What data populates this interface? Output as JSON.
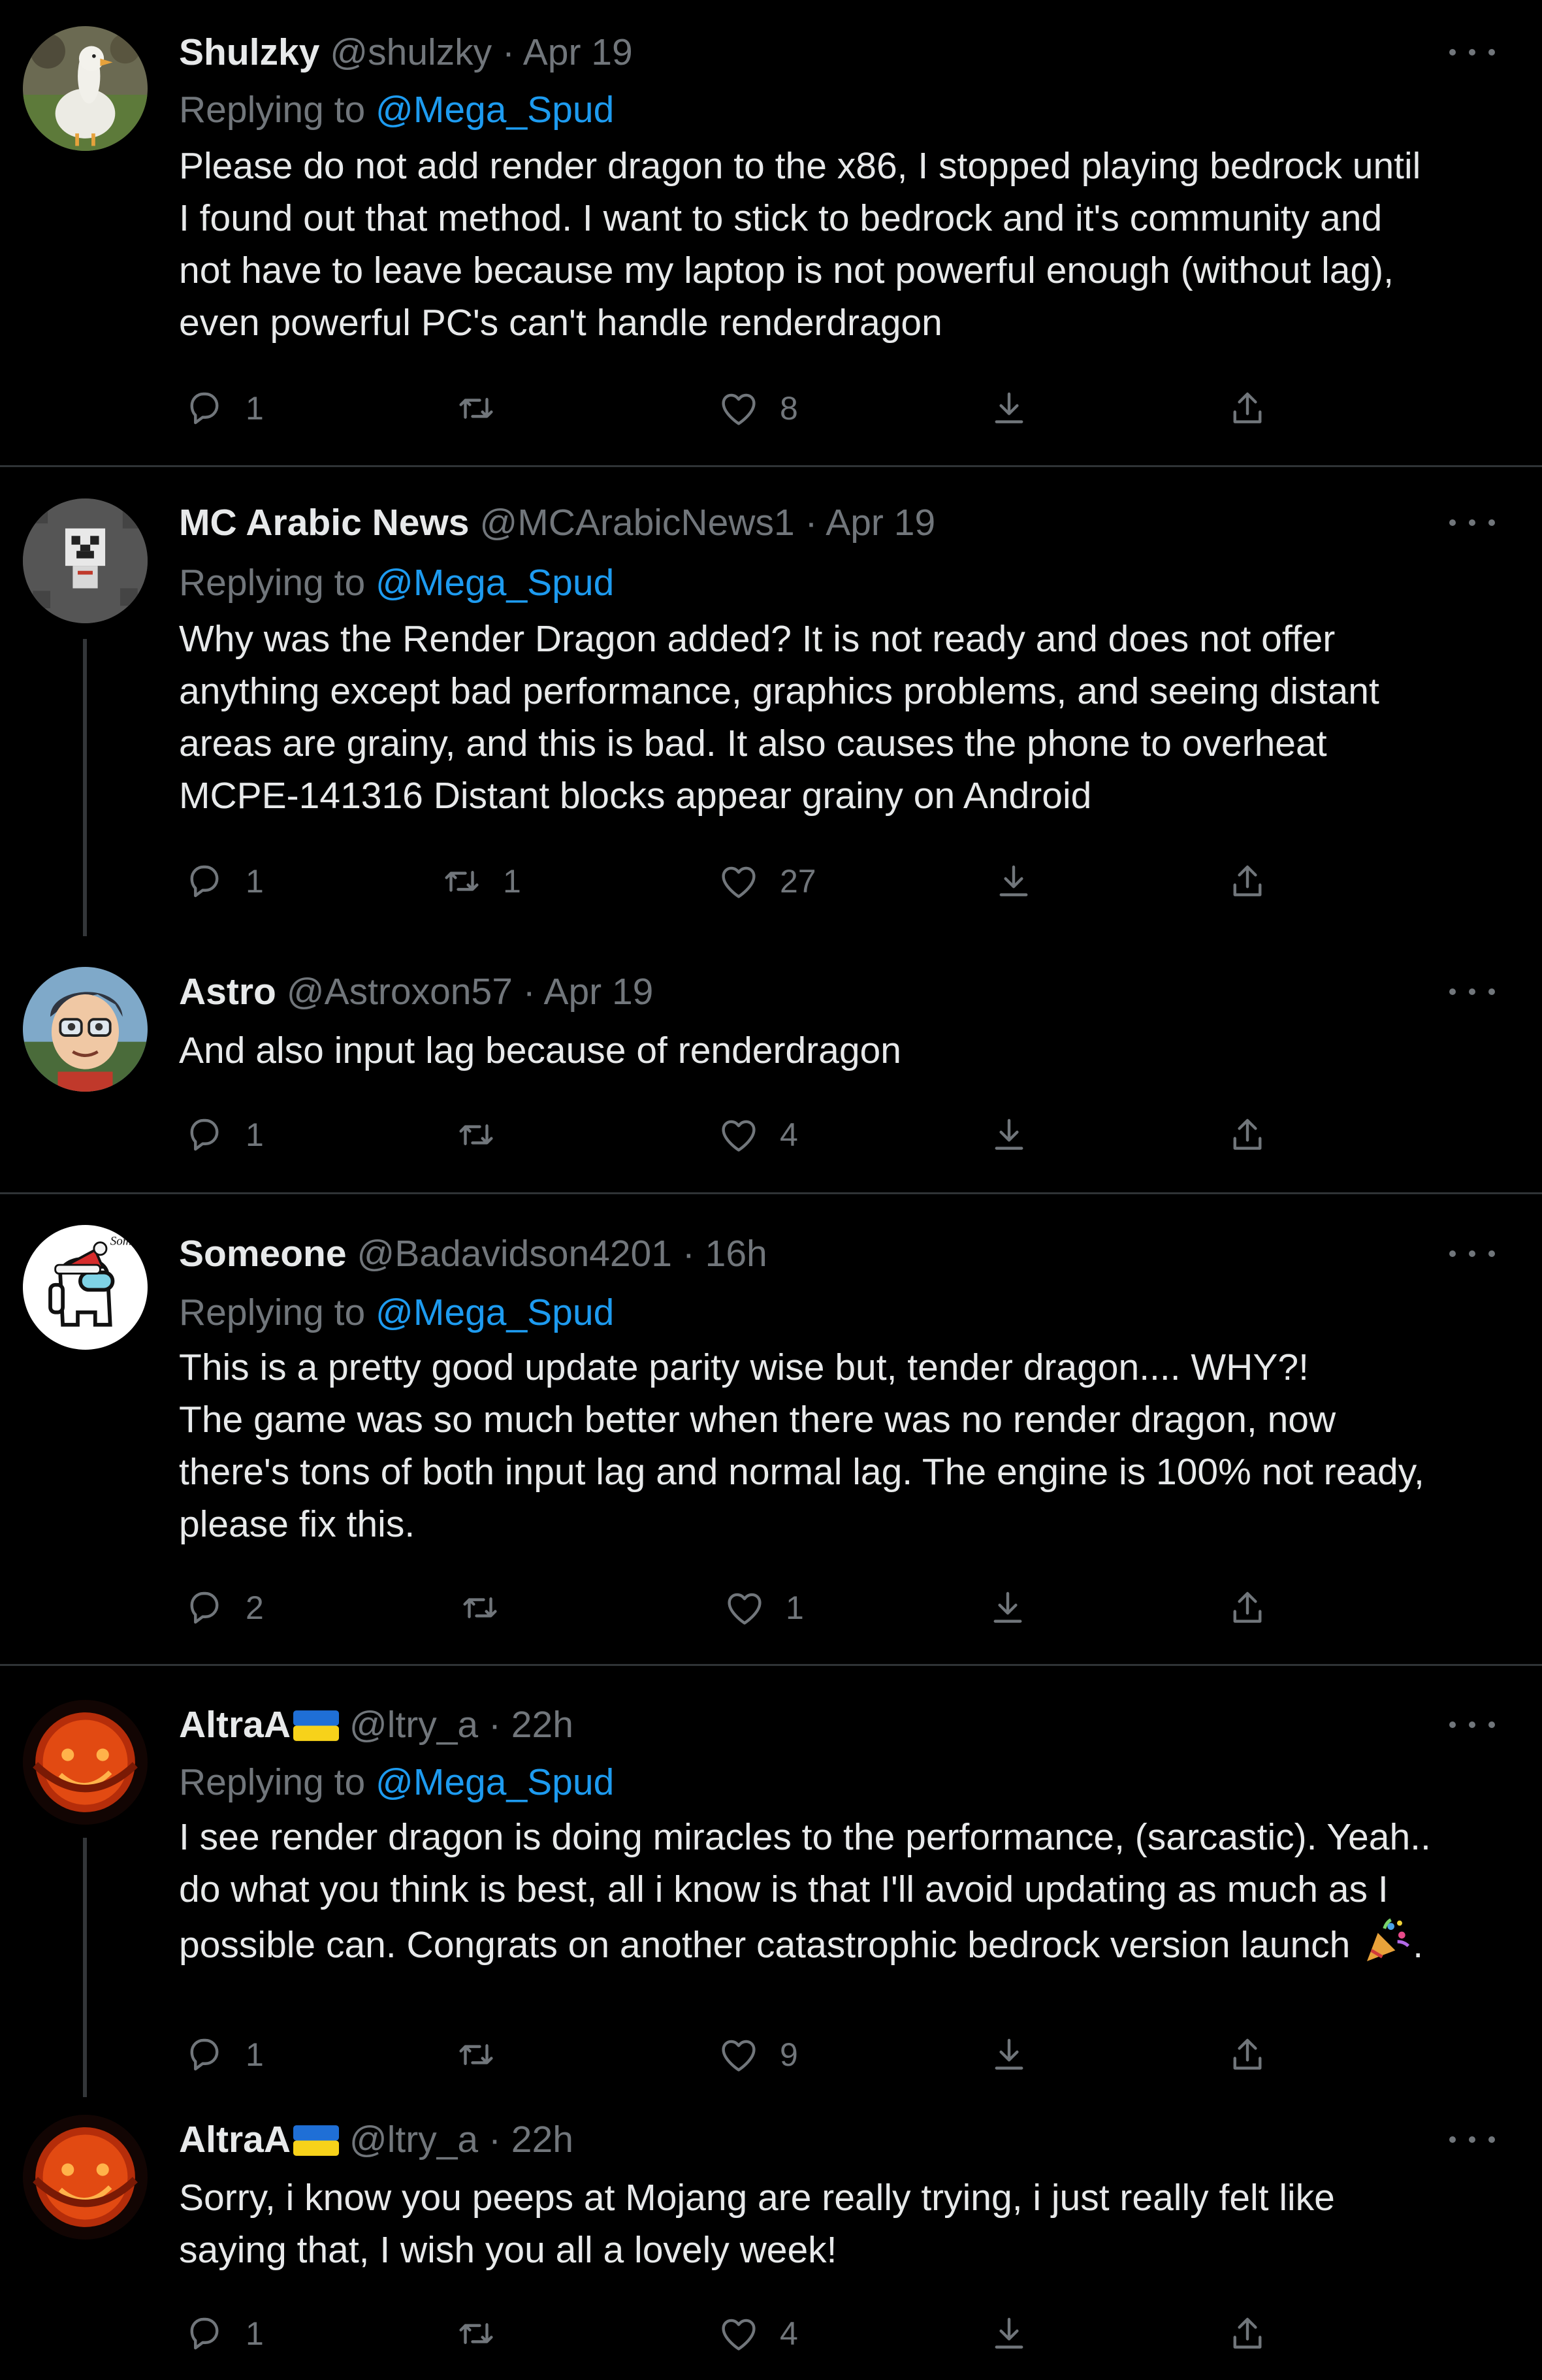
{
  "tweets": [
    {
      "name": "Shulzky",
      "handle": "@shulzky",
      "separator": "·",
      "time": "Apr 19",
      "replying_label": "Replying to",
      "replying_to": "@Mega_Spud",
      "lines": [
        "Please do not add render dragon to the x86, I stopped playing bedrock until",
        "I found out that method. I want to stick to bedrock and it's community and",
        "not have to leave because my laptop is not powerful enough (without lag),",
        "even powerful PC's can't handle renderdragon"
      ],
      "reply_count": "1",
      "retweet_count": "",
      "like_count": "8"
    },
    {
      "name": "MC Arabic News",
      "handle": "@MCArabicNews1",
      "separator": "·",
      "time": "Apr 19",
      "replying_label": "Replying to",
      "replying_to": "@Mega_Spud",
      "lines": [
        "Why was the Render Dragon added? It is not ready and does not offer",
        "anything except bad performance, graphics problems, and seeing distant",
        "areas are grainy, and this is bad. It also causes the phone to overheat",
        "MCPE-141316 Distant blocks appear grainy on Android"
      ],
      "reply_count": "1",
      "retweet_count": "1",
      "like_count": "27"
    },
    {
      "name": "Astro",
      "handle": "@Astroxon57",
      "separator": "·",
      "time": "Apr 19",
      "lines": [
        "And also input lag because of renderdragon"
      ],
      "reply_count": "1",
      "retweet_count": "",
      "like_count": "4"
    },
    {
      "name": "Someone",
      "handle": "@Badavidson4201",
      "separator": "·",
      "time": "16h",
      "replying_label": "Replying to",
      "replying_to": "@Mega_Spud",
      "lines": [
        "This is a pretty good update parity wise but, tender dragon.... WHY?!",
        "The game was so much better when there was no render dragon, now",
        "there's tons of both input lag and normal lag. The engine is 100% not ready,",
        "please fix this."
      ],
      "reply_count": "2",
      "retweet_count": "",
      "like_count": "1"
    },
    {
      "name": "AltraA",
      "handle": "@ltry_a",
      "separator": "·",
      "time": "22h",
      "replying_label": "Replying to",
      "replying_to": "@Mega_Spud",
      "lines": [
        "I see render dragon is doing miracles to the performance, (sarcastic). Yeah..",
        "do what you think is best, all i know is that I'll avoid updating as much as I",
        "possible can. Congrats on another catastrophic bedrock version launch",
        "."
      ],
      "reply_count": "1",
      "retweet_count": "",
      "like_count": "9"
    },
    {
      "name": "AltraA",
      "handle": "@ltry_a",
      "separator": "·",
      "time": "22h",
      "lines": [
        "Sorry, i know you peeps at Mojang are really trying, i just really felt like",
        "saying that, I wish you all a lovely week!"
      ],
      "reply_count": "1",
      "retweet_count": "",
      "like_count": "4"
    }
  ],
  "icons": {
    "reply": "reply-icon",
    "retweet": "retweet-icon",
    "like": "heart-icon",
    "download": "download-icon",
    "share": "share-icon",
    "more": "more-icon"
  },
  "colors": {
    "background": "#000000",
    "text": "#e7e9ea",
    "muted": "#71767b",
    "link": "#1d9bf0",
    "divider": "#2f3336"
  }
}
